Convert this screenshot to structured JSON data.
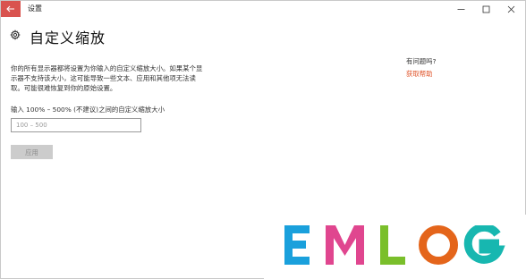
{
  "window": {
    "title": "设置",
    "controls": {
      "minimize": "—",
      "maximize": "☐",
      "close": "✕"
    }
  },
  "page": {
    "title": "自定义缩放",
    "description_line1": "你的所有显示器都将设置为你输入的自定义缩放大小。如果某个显",
    "description_line2": "示器不支持该大小，这可能导致一些文本、应用和其他项无法读",
    "description_line3": "取。可能很难恢复到你的原始设置。",
    "input_label": "输入 100% – 500% (不建议)之间的自定义缩放大小",
    "input_placeholder": "100 – 500",
    "input_value": "",
    "apply_button": "应用"
  },
  "help": {
    "question": "有问题吗?",
    "link": "获取帮助"
  },
  "colors": {
    "back_button": "#d9534f",
    "link": "#e0542a",
    "apply_disabled": "#cccccc"
  },
  "watermark": {
    "text": "EMLOG",
    "colors": [
      "#1aa0dc",
      "#e0468f",
      "#7abf2b",
      "#e4651b",
      "#17b7b0"
    ]
  }
}
